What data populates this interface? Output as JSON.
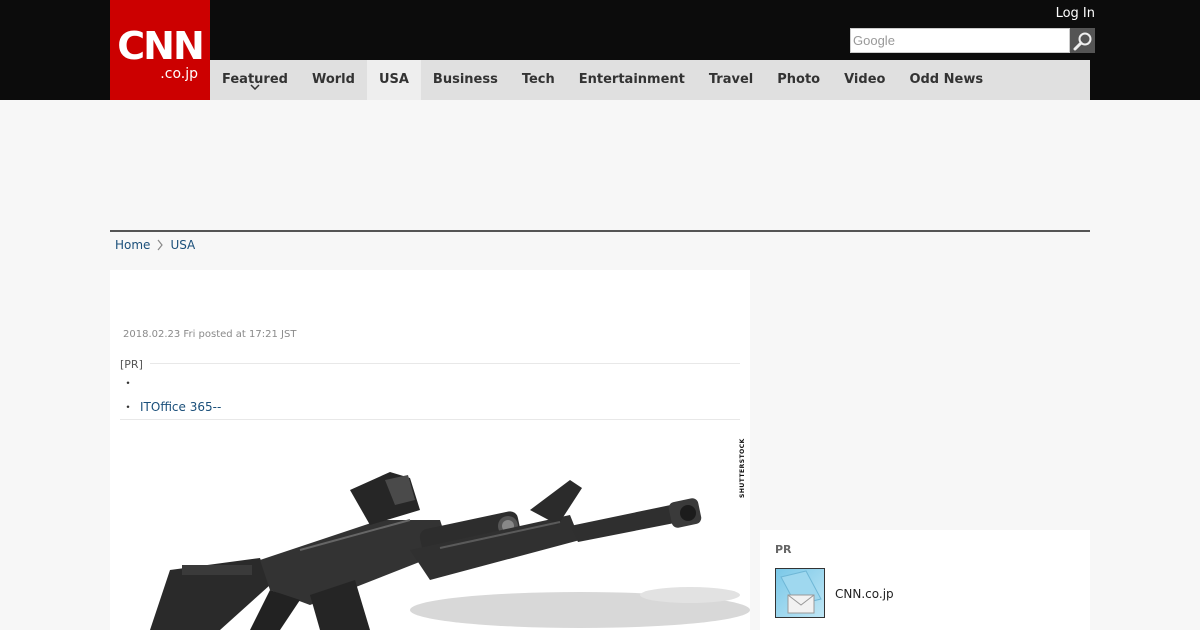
{
  "header": {
    "logo_main": "CNN",
    "logo_sub": ".co.jp",
    "login": "Log In",
    "search_placeholder": "Google"
  },
  "nav": {
    "items": [
      {
        "label": "Featured"
      },
      {
        "label": "World"
      },
      {
        "label": "USA"
      },
      {
        "label": "Business"
      },
      {
        "label": "Tech"
      },
      {
        "label": "Entertainment"
      },
      {
        "label": "Travel"
      },
      {
        "label": "Photo"
      },
      {
        "label": "Video"
      },
      {
        "label": "Odd News"
      }
    ],
    "active": "USA"
  },
  "breadcrumb": {
    "home": "Home",
    "current": "USA"
  },
  "article": {
    "posted": "2018.02.23 Fri posted at 17:21 JST",
    "pr_label": "[PR]",
    "pr_items": [
      {
        "bullet": "・",
        "text": ""
      },
      {
        "bullet": "・",
        "text": "ITOffice 365--"
      }
    ],
    "photo_credit": "SHUTTERSTOCK"
  },
  "sidebar": {
    "pr_title": "PR",
    "pr_item": "CNN.co.jp"
  },
  "colors": {
    "brand_red": "#cc0000",
    "topbar": "#0c0c0c",
    "nav_bg": "#e0e0e0",
    "link": "#1a4f7a"
  }
}
